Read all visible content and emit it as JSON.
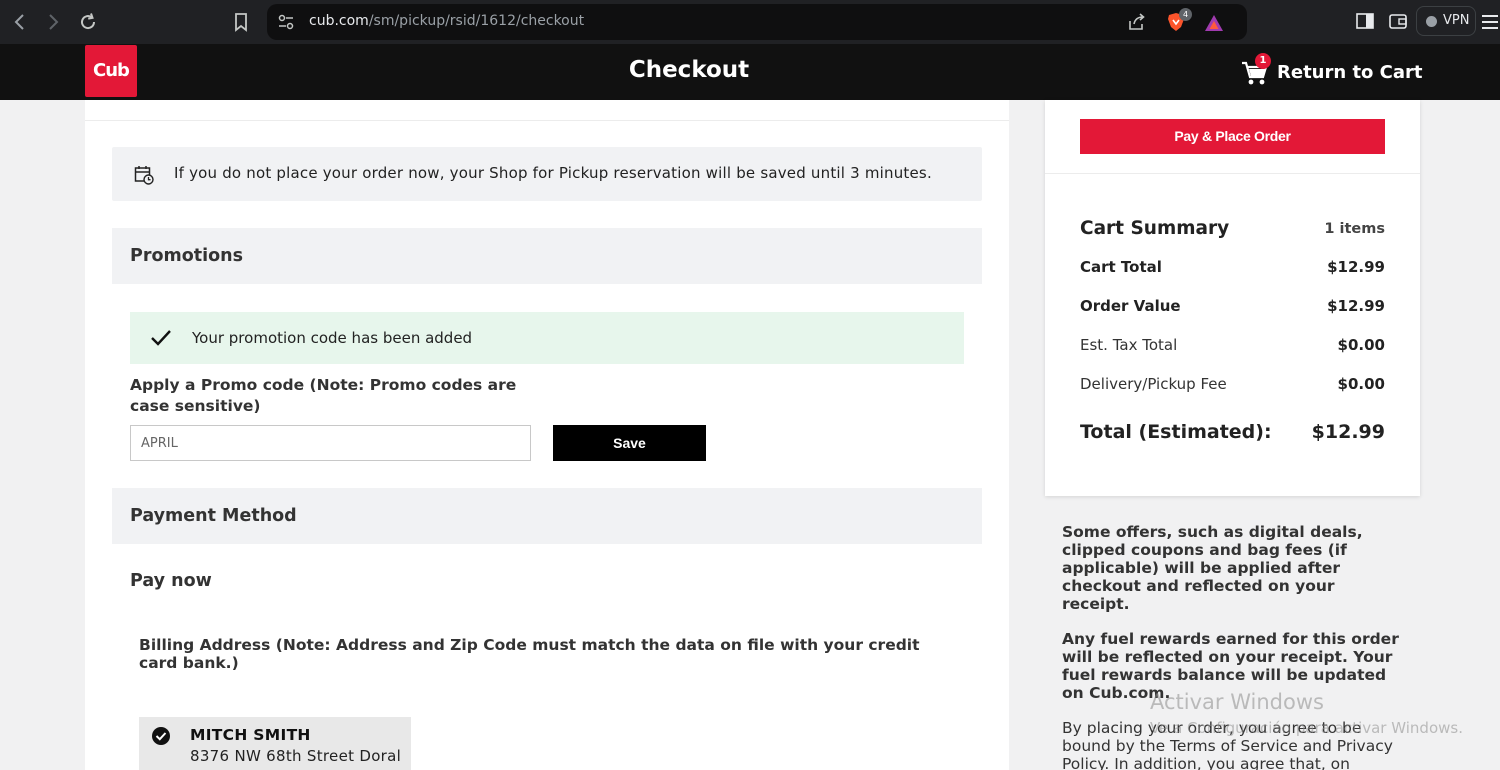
{
  "browser": {
    "url_host": "cub.com",
    "url_path": "/sm/pickup/rsid/1612/checkout",
    "brave_badge": "4",
    "vpn_label": "VPN"
  },
  "header": {
    "logo_text": "Cub",
    "title": "Checkout",
    "cart_count": "1",
    "return_label": "Return to Cart"
  },
  "notice": {
    "text": "If you do not place your order now, your Shop for Pickup reservation will be saved until 3 minutes."
  },
  "promotions": {
    "heading": "Promotions",
    "success_message": "Your promotion code has been added",
    "apply_label": "Apply a Promo code (Note: Promo codes are case sensitive)",
    "input_value": "APRIL",
    "save_label": "Save"
  },
  "payment": {
    "heading": "Payment Method",
    "pay_now": "Pay now",
    "billing_note": "Billing Address (Note: Address and Zip Code must match the data on file with your credit card bank.)",
    "address": {
      "name": "MITCH SMITH",
      "street": "8376 NW 68th Street Doral"
    }
  },
  "summary": {
    "place_order_label": "Pay & Place Order",
    "heading": "Cart Summary",
    "items_count": "1 items",
    "rows": [
      {
        "label": "Cart Total",
        "value": "$12.99"
      },
      {
        "label": "Order Value",
        "value": "$12.99"
      },
      {
        "label": "Est. Tax Total",
        "value": "$0.00"
      },
      {
        "label": "Delivery/Pickup Fee",
        "value": "$0.00"
      }
    ],
    "total_label": "Total (Estimated):",
    "total_value": "$12.99"
  },
  "side_notes": {
    "offers": "Some offers, such as digital deals, clipped coupons and bag fees (if applicable) will be applied after checkout and reflected on your receipt.",
    "fuel": "Any fuel rewards earned for this order will be reflected on your receipt. Your fuel rewards balance will be updated on Cub.com.",
    "terms": "By placing your order, you agree to be bound by the Terms of Service and Privacy Policy. In addition, you agree that, on"
  },
  "watermark": {
    "line1": "Activar Windows",
    "line2": "Ve a Configuración para activar Windows."
  },
  "colors": {
    "brand_red": "#e31837",
    "header_bg": "#111111",
    "success_bg": "#e7f6ec"
  }
}
